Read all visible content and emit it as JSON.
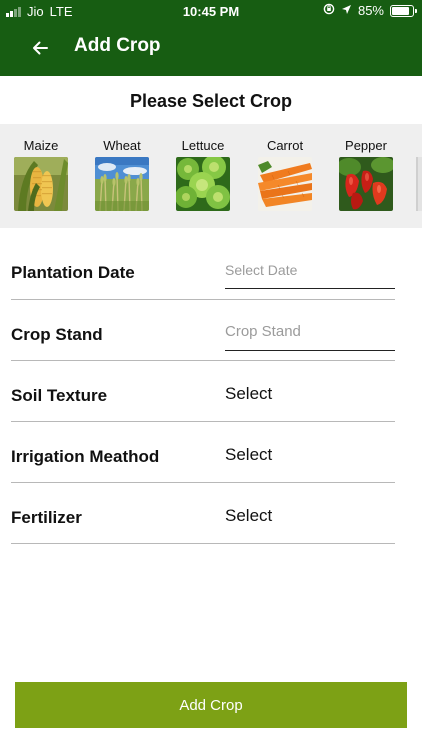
{
  "status_bar": {
    "carrier": "Jio",
    "network": "LTE",
    "time": "10:45 PM",
    "battery_percent": "85%",
    "battery_level": 0.85
  },
  "app_bar": {
    "title": "Add Crop",
    "back_icon": "arrow-left-icon"
  },
  "section_title": "Please Select Crop",
  "crops": [
    {
      "label": "Maize"
    },
    {
      "label": "Wheat"
    },
    {
      "label": "Lettuce"
    },
    {
      "label": "Carrot"
    },
    {
      "label": "Pepper"
    }
  ],
  "form": {
    "plantation_date": {
      "label": "Plantation Date",
      "placeholder": "Select Date"
    },
    "crop_stand": {
      "label": "Crop Stand",
      "placeholder": "Crop Stand"
    },
    "soil_texture": {
      "label": "Soil Texture",
      "value": "Select"
    },
    "irrigation_method": {
      "label": "Irrigation Meathod",
      "value": "Select"
    },
    "fertilizer": {
      "label": "Fertilizer",
      "value": "Select"
    }
  },
  "submit_label": "Add Crop",
  "colors": {
    "header_green": "#175d12",
    "button_green": "#7da115",
    "strip_bg": "#efefef"
  }
}
